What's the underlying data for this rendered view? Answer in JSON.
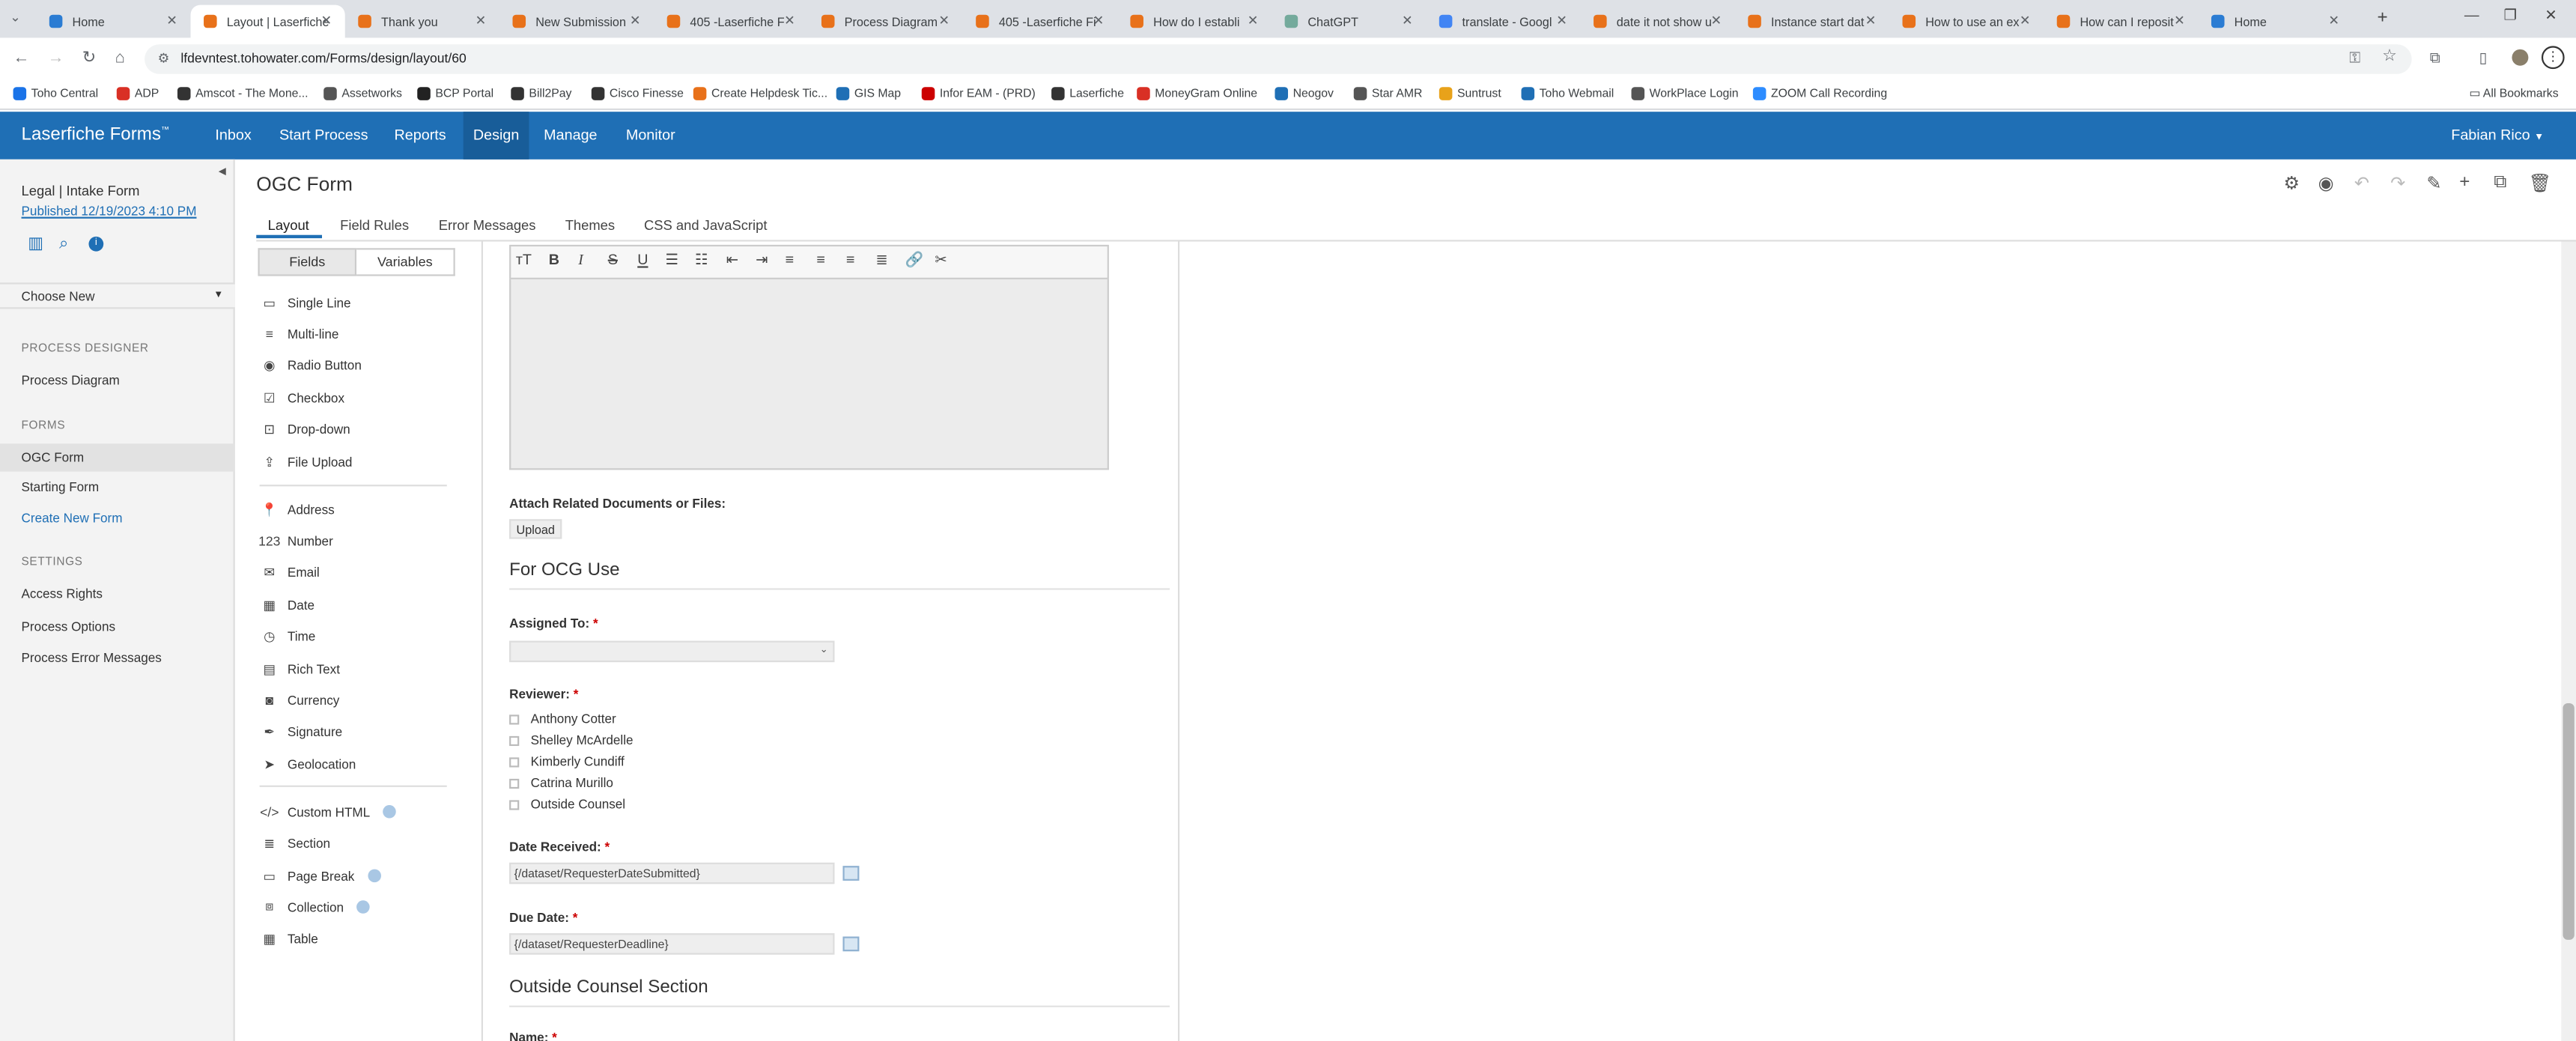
{
  "browser": {
    "tabs": [
      {
        "title": "Home",
        "color": "#2b7cd3"
      },
      {
        "title": "Layout | Laserfiche",
        "color": "#e8711a"
      },
      {
        "title": "Thank you",
        "color": "#e8711a"
      },
      {
        "title": "New Submission",
        "color": "#e8711a"
      },
      {
        "title": "405 -Laserfiche F",
        "color": "#e8711a"
      },
      {
        "title": "Process Diagram",
        "color": "#e8711a"
      },
      {
        "title": "405 -Laserfiche Fi",
        "color": "#e8711a"
      },
      {
        "title": "How do I establi",
        "color": "#e8711a"
      },
      {
        "title": "ChatGPT",
        "color": "#74aa9c"
      },
      {
        "title": "translate - Googl",
        "color": "#4285f4"
      },
      {
        "title": "date it not show u",
        "color": "#e8711a"
      },
      {
        "title": "Instance start dat",
        "color": "#e8711a"
      },
      {
        "title": "How to use an ex",
        "color": "#e8711a"
      },
      {
        "title": "How can I reposit",
        "color": "#e8711a"
      },
      {
        "title": "Home",
        "color": "#2b7cd3"
      }
    ],
    "url": "lfdevntest.tohowater.com/Forms/design/layout/60",
    "bookmarks": [
      "Toho Central",
      "ADP",
      "Amscot - The Mone...",
      "Assetworks",
      "BCP Portal",
      "Bill2Pay",
      "Cisco Finesse",
      "Create Helpdesk Tic...",
      "GIS Map",
      "Infor EAM - (PRD)",
      "Laserfiche",
      "MoneyGram Online",
      "Neogov",
      "Star AMR",
      "Suntrust",
      "Toho Webmail",
      "WorkPlace Login",
      "ZOOM Call Recording"
    ],
    "all_bookmarks": "All Bookmarks"
  },
  "app": {
    "brand": "Laserfiche Forms",
    "brand_tm": "™",
    "nav": [
      "Inbox",
      "Start Process",
      "Reports",
      "Design",
      "Manage",
      "Monitor"
    ],
    "user": "Fabian Rico",
    "accent": "#1f6fb5"
  },
  "sidebar": {
    "process_name": "Legal | Intake Form",
    "published": "Published 12/19/2023 4:10 PM",
    "choose_new": "Choose New",
    "process_designer_heading": "PROCESS DESIGNER",
    "process_diagram": "Process Diagram",
    "forms_heading": "FORMS",
    "forms": [
      "OGC Form",
      "Starting Form",
      "Create New Form"
    ],
    "settings_heading": "SETTINGS",
    "settings": [
      "Access Rights",
      "Process Options",
      "Process Error Messages"
    ]
  },
  "main": {
    "title": "OGC Form",
    "subtabs": [
      "Layout",
      "Field Rules",
      "Error Messages",
      "Themes",
      "CSS and JavaScript"
    ]
  },
  "palette": {
    "tab_fields": "Fields",
    "tab_variables": "Variables",
    "group1": [
      "Single Line",
      "Multi-line",
      "Radio Button",
      "Checkbox",
      "Drop-down",
      "File Upload"
    ],
    "group2": [
      "Address",
      "Number",
      "Email",
      "Date",
      "Time",
      "Rich Text",
      "Currency",
      "Signature",
      "Geolocation"
    ],
    "group3": [
      "Custom HTML",
      "Section",
      "Page Break",
      "Collection",
      "Table"
    ]
  },
  "form": {
    "attach_label": "Attach Related Documents or Files:",
    "upload_label": "Upload",
    "section1": "For OCG Use",
    "assigned_label": "Assigned To:",
    "reviewer_label": "Reviewer:",
    "reviewers": [
      "Anthony Cotter",
      "Shelley McArdelle",
      "Kimberly Cundiff",
      "Catrina Murillo",
      "Outside Counsel"
    ],
    "date_received_label": "Date Received:",
    "date_received_value": "{/dataset/RequesterDateSubmitted}",
    "due_date_label": "Due Date:",
    "due_date_value": "{/dataset/RequesterDeadline}",
    "section2": "Outside Counsel Section",
    "name_label": "Name:",
    "required_mark": "*"
  }
}
